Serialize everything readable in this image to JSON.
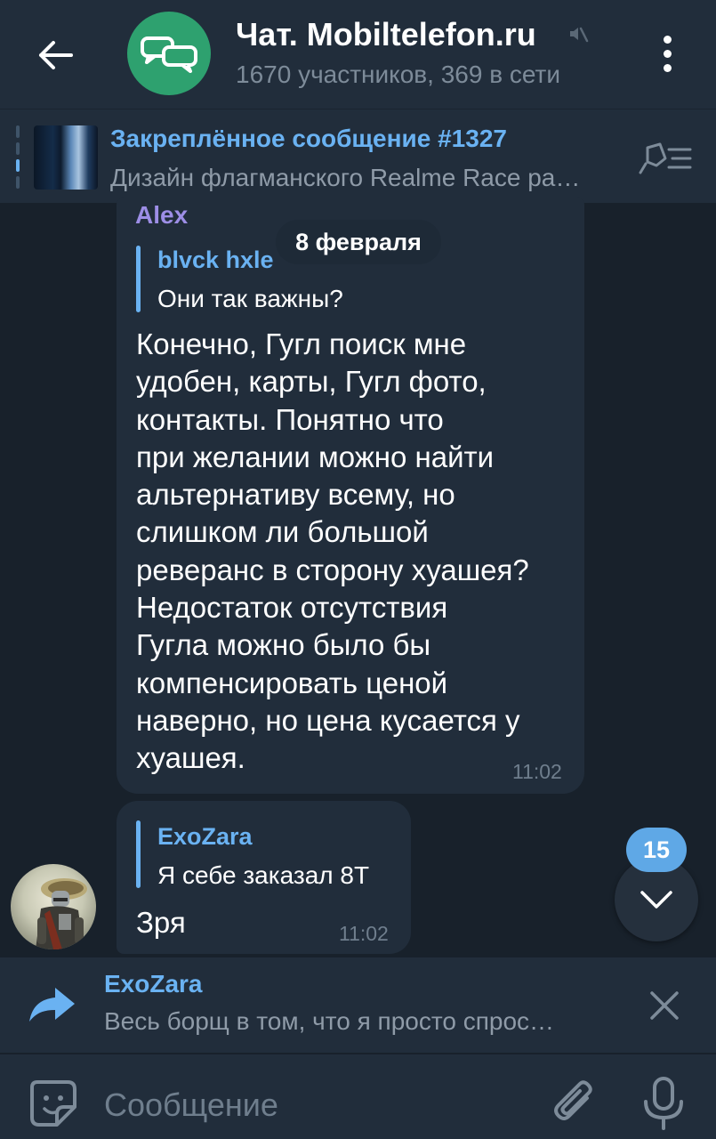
{
  "header": {
    "title": "Чат. Mobiltelefon.ru",
    "subtitle": "1670 участников, 369 в сети",
    "back_icon": "arrow-left-icon",
    "avatar_icon": "chat-bubbles-icon",
    "mute_icon": "muted-speaker-icon",
    "menu_icon": "more-vertical-icon"
  },
  "pinned": {
    "title": "Закреплённое сообщение #1327",
    "text": "Дизайн флагманского Realme Race ра…",
    "icon": "pin-list-icon"
  },
  "date_separator": "8 февраля",
  "messages": [
    {
      "sender": "Alex",
      "reply_to": {
        "name": "blvck hxle",
        "text": "Они так важны?"
      },
      "text": "Конечно, Гугл поиск мне\nудобен, карты, Гугл фото,\nконтакты. Понятно что\nпри желании можно найти\nальтернативу всему, но\nслишком ли большой\nреверанс в сторону хуашея?\nНедостаток отсутствия\nГугла можно было бы\nкомпенсировать ценой\nнаверно, но цена кусается у\nхуашея.",
      "time": "11:02"
    },
    {
      "reply_to": {
        "name": "ExoZara",
        "text": "Я себе заказал 8T"
      },
      "text": "Зря",
      "time": "11:02"
    }
  ],
  "scroll_down": {
    "unread_count": "15",
    "icon": "chevron-down-icon"
  },
  "forward": {
    "name": "ExoZara",
    "text": "Весь борщ в том, что я просто спрос…",
    "icon": "forward-arrow-icon",
    "close_icon": "close-icon"
  },
  "input": {
    "placeholder": "Сообщение",
    "emoji_icon": "sticker-smile-icon",
    "attach_icon": "paperclip-icon",
    "mic_icon": "microphone-icon"
  },
  "colors": {
    "background": "#18212b",
    "panel": "#212d3b",
    "accent": "#6ab2f2",
    "sender_name": "#9d8ee6",
    "group_avatar": "#2ea16f",
    "secondary_text": "#8f9ba8"
  }
}
